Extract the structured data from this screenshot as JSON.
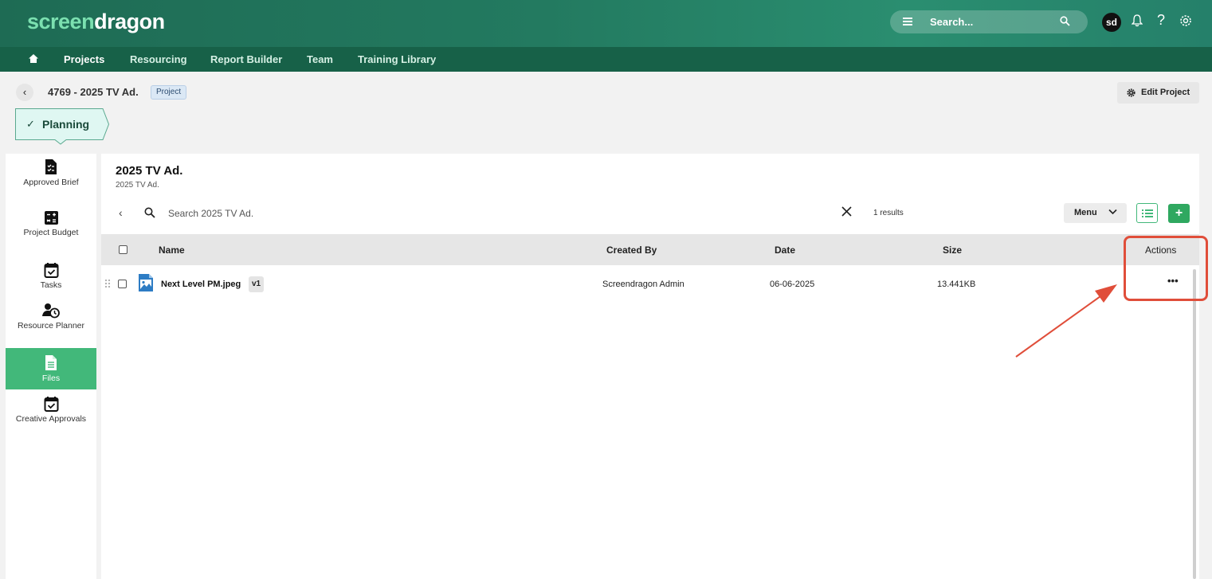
{
  "app": {
    "logo_part1": "screen",
    "logo_part2": "dragon",
    "search_placeholder": "Search...",
    "avatar_initials": "sd",
    "help_label": "?"
  },
  "nav": {
    "items": [
      {
        "label": "Projects",
        "active": true
      },
      {
        "label": "Resourcing"
      },
      {
        "label": "Report Builder"
      },
      {
        "label": "Team"
      },
      {
        "label": "Training Library"
      }
    ]
  },
  "project": {
    "title": "4769 - 2025 TV Ad.",
    "badge": "Project",
    "edit_label": "Edit Project",
    "stage": "Planning"
  },
  "sidebar": {
    "items": [
      {
        "label": "Approved Brief",
        "icon": "brief-icon"
      },
      {
        "label": "Project Budget",
        "icon": "budget-icon"
      },
      {
        "label": "Tasks",
        "icon": "tasks-icon"
      },
      {
        "label": "Resource Planner",
        "icon": "resource-icon"
      },
      {
        "label": "Files",
        "icon": "file-icon",
        "active": true
      },
      {
        "label": "Creative Approvals",
        "icon": "approvals-icon"
      }
    ]
  },
  "main": {
    "title": "2025 TV Ad.",
    "subtitle": "2025 TV Ad.",
    "search_placeholder": "Search 2025 TV Ad.",
    "results": "1 results",
    "menu_label": "Menu",
    "add_label": "+"
  },
  "table": {
    "columns": [
      "Name",
      "Created By",
      "Date",
      "Size",
      "Actions"
    ],
    "rows": [
      {
        "name": "Next Level PM.jpeg",
        "version": "v1",
        "created_by": "Screendragon Admin",
        "date": "06-06-2025",
        "size": "13.441KB",
        "actions": "•••"
      }
    ]
  },
  "colors": {
    "brand_dark": "#176148",
    "brand_accent": "#42b87a",
    "annotation": "#e04e3a"
  }
}
